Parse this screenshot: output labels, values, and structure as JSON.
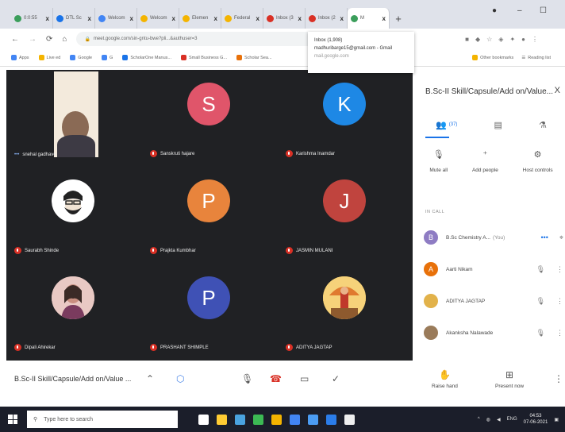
{
  "browser": {
    "tabs": [
      {
        "label": "0:0:55",
        "color": "#3b9e5b"
      },
      {
        "label": "DTL Sc",
        "color": "#1a73e8"
      },
      {
        "label": "Welcom",
        "color": "#4285f4"
      },
      {
        "label": "Welcom",
        "color": "#f4b400"
      },
      {
        "label": "Elemen",
        "color": "#f4b400"
      },
      {
        "label": "Federal",
        "color": "#f4b400"
      },
      {
        "label": "Inbox (3",
        "color": "#d93025"
      },
      {
        "label": "Inbox (2",
        "color": "#d93025"
      },
      {
        "label": "M",
        "color": "#3b9e5b"
      }
    ],
    "new_tab": "+",
    "window_controls": {
      "minimize": "–",
      "maximize": "☐"
    },
    "url": "meet.google.com/sin-gntu-bwe?pli...&authuser=3",
    "bookmarks": [
      {
        "label": "Apps",
        "color": "#4285f4"
      },
      {
        "label": "Live ed",
        "color": "#f4b400"
      },
      {
        "label": "Google",
        "color": "#4285f4"
      },
      {
        "label": "G",
        "color": "#4285f4"
      },
      {
        "label": "ScholarOne Manus...",
        "color": "#1a73e8"
      },
      {
        "label": "Small Business G...",
        "color": "#d93025"
      },
      {
        "label": "Scholar Sea...",
        "color": "#e8710a"
      }
    ],
    "other_bookmarks": "Other bookmarks",
    "reading_list": "Reading list"
  },
  "tooltip": {
    "title": "Inbox (1,908)",
    "email": "madhuribarge15@gmail.com - Gmail",
    "sub": "mail.google.com"
  },
  "participants_grid": [
    {
      "name": "snehal gadhave",
      "initial": "",
      "color": "#f3eadc",
      "kind": "photo"
    },
    {
      "name": "Sanskruti hajare",
      "initial": "S",
      "color": "#e0556a",
      "kind": "initial"
    },
    {
      "name": "Karishma Inamdar",
      "initial": "K",
      "color": "#1e88e5",
      "kind": "initial"
    },
    {
      "name": "Saurabh Shinde",
      "initial": "",
      "color": "#ffffff",
      "kind": "photo"
    },
    {
      "name": "Prajkta Kumbhar",
      "initial": "P",
      "color": "#e8843c",
      "kind": "initial"
    },
    {
      "name": "JASMIN MULANI",
      "initial": "J",
      "color": "#c0443e",
      "kind": "initial"
    },
    {
      "name": "Dipali Ahirekar",
      "initial": "",
      "color": "#d8b4b0",
      "kind": "photo"
    },
    {
      "name": "PRASHANT SHIMPLE",
      "initial": "P",
      "color": "#3f51b5",
      "kind": "initial"
    },
    {
      "name": "ADITYA JAGTAP",
      "initial": "",
      "color": "#f0c040",
      "kind": "photo"
    }
  ],
  "panel": {
    "title": "B.Sc-II Skill/Capsule/Add on/Value...",
    "close": "X",
    "people_count": "(37)",
    "actions": [
      {
        "label": "Mute all",
        "icon": "🎙"
      },
      {
        "label": "Add people",
        "icon": "⁺"
      },
      {
        "label": "Host controls",
        "icon": "⚙"
      }
    ],
    "section_label": "IN CALL",
    "people": [
      {
        "name": "B.Sc Chemistry A...",
        "suffix": "(You)",
        "initial": "B",
        "color": "#8e7cc3"
      },
      {
        "name": "Aarti Nikam",
        "suffix": "",
        "initial": "A",
        "color": "#e8710a"
      },
      {
        "name": "ADITYA JAGTAP",
        "suffix": "",
        "initial": "",
        "color": "#e2b24a"
      },
      {
        "name": "Akanksha Nalawade",
        "suffix": "",
        "initial": "",
        "color": "#9a7b5a"
      }
    ]
  },
  "controls": {
    "meeting_title": "B.Sc-II Skill/Capsule/Add on/Value ...",
    "raise_hand": "Raise hand",
    "present_now": "Present now"
  },
  "taskbar": {
    "search_placeholder": "Type here to search",
    "language": "ENG",
    "time": "04:53",
    "date": "07-06-2021",
    "app_colors": [
      "#ffffff",
      "#ffcc33",
      "#4aa3df",
      "#3cba54",
      "#f4b400",
      "#4285f4",
      "#4b9cf3",
      "#2b7de9",
      "#eeeeee"
    ]
  }
}
